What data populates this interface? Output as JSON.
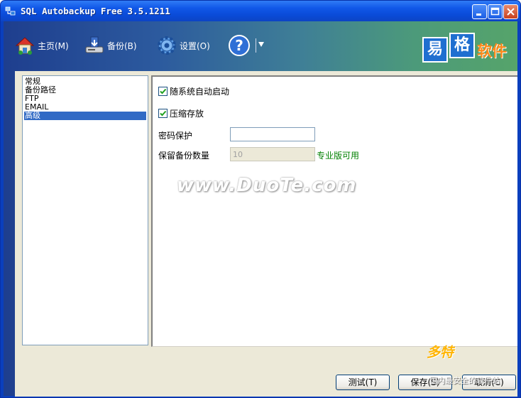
{
  "window": {
    "title": "SQL Autobackup Free 3.5.1211"
  },
  "toolbar": {
    "items": [
      {
        "label": "主页(M)",
        "icon": "home-icon"
      },
      {
        "label": "备份(B)",
        "icon": "backup-icon"
      },
      {
        "label": "设置(O)",
        "icon": "gear-icon"
      },
      {
        "label": "",
        "icon": "help-icon"
      }
    ]
  },
  "logo": {
    "char1": "易",
    "char2": "格",
    "brand": "软件"
  },
  "tree": {
    "items": [
      "常规",
      "备份路径",
      "FTP",
      "EMAIL",
      "高级"
    ],
    "selected": "高级"
  },
  "settings": {
    "autostart_label": "随系统自动启动",
    "autostart_checked": true,
    "compress_label": "压缩存放",
    "compress_checked": true,
    "password_label": "密码保护",
    "password_value": "",
    "keep_count_label": "保留备份数量",
    "keep_count_value": "10",
    "pro_only_note": "专业版可用"
  },
  "watermark": "www.DuoTe.com",
  "buttons": {
    "test": "测试(T)",
    "save": "保存(S)",
    "cancel": "取消(C)"
  },
  "corner_watermark": {
    "big": "多特",
    "small": "国内最安全的软件站"
  },
  "colors": {
    "titlebar": "#0a4bd8",
    "selection": "#316ac5",
    "pro_note": "#008000",
    "brand_orange": "#ff8a1a"
  }
}
